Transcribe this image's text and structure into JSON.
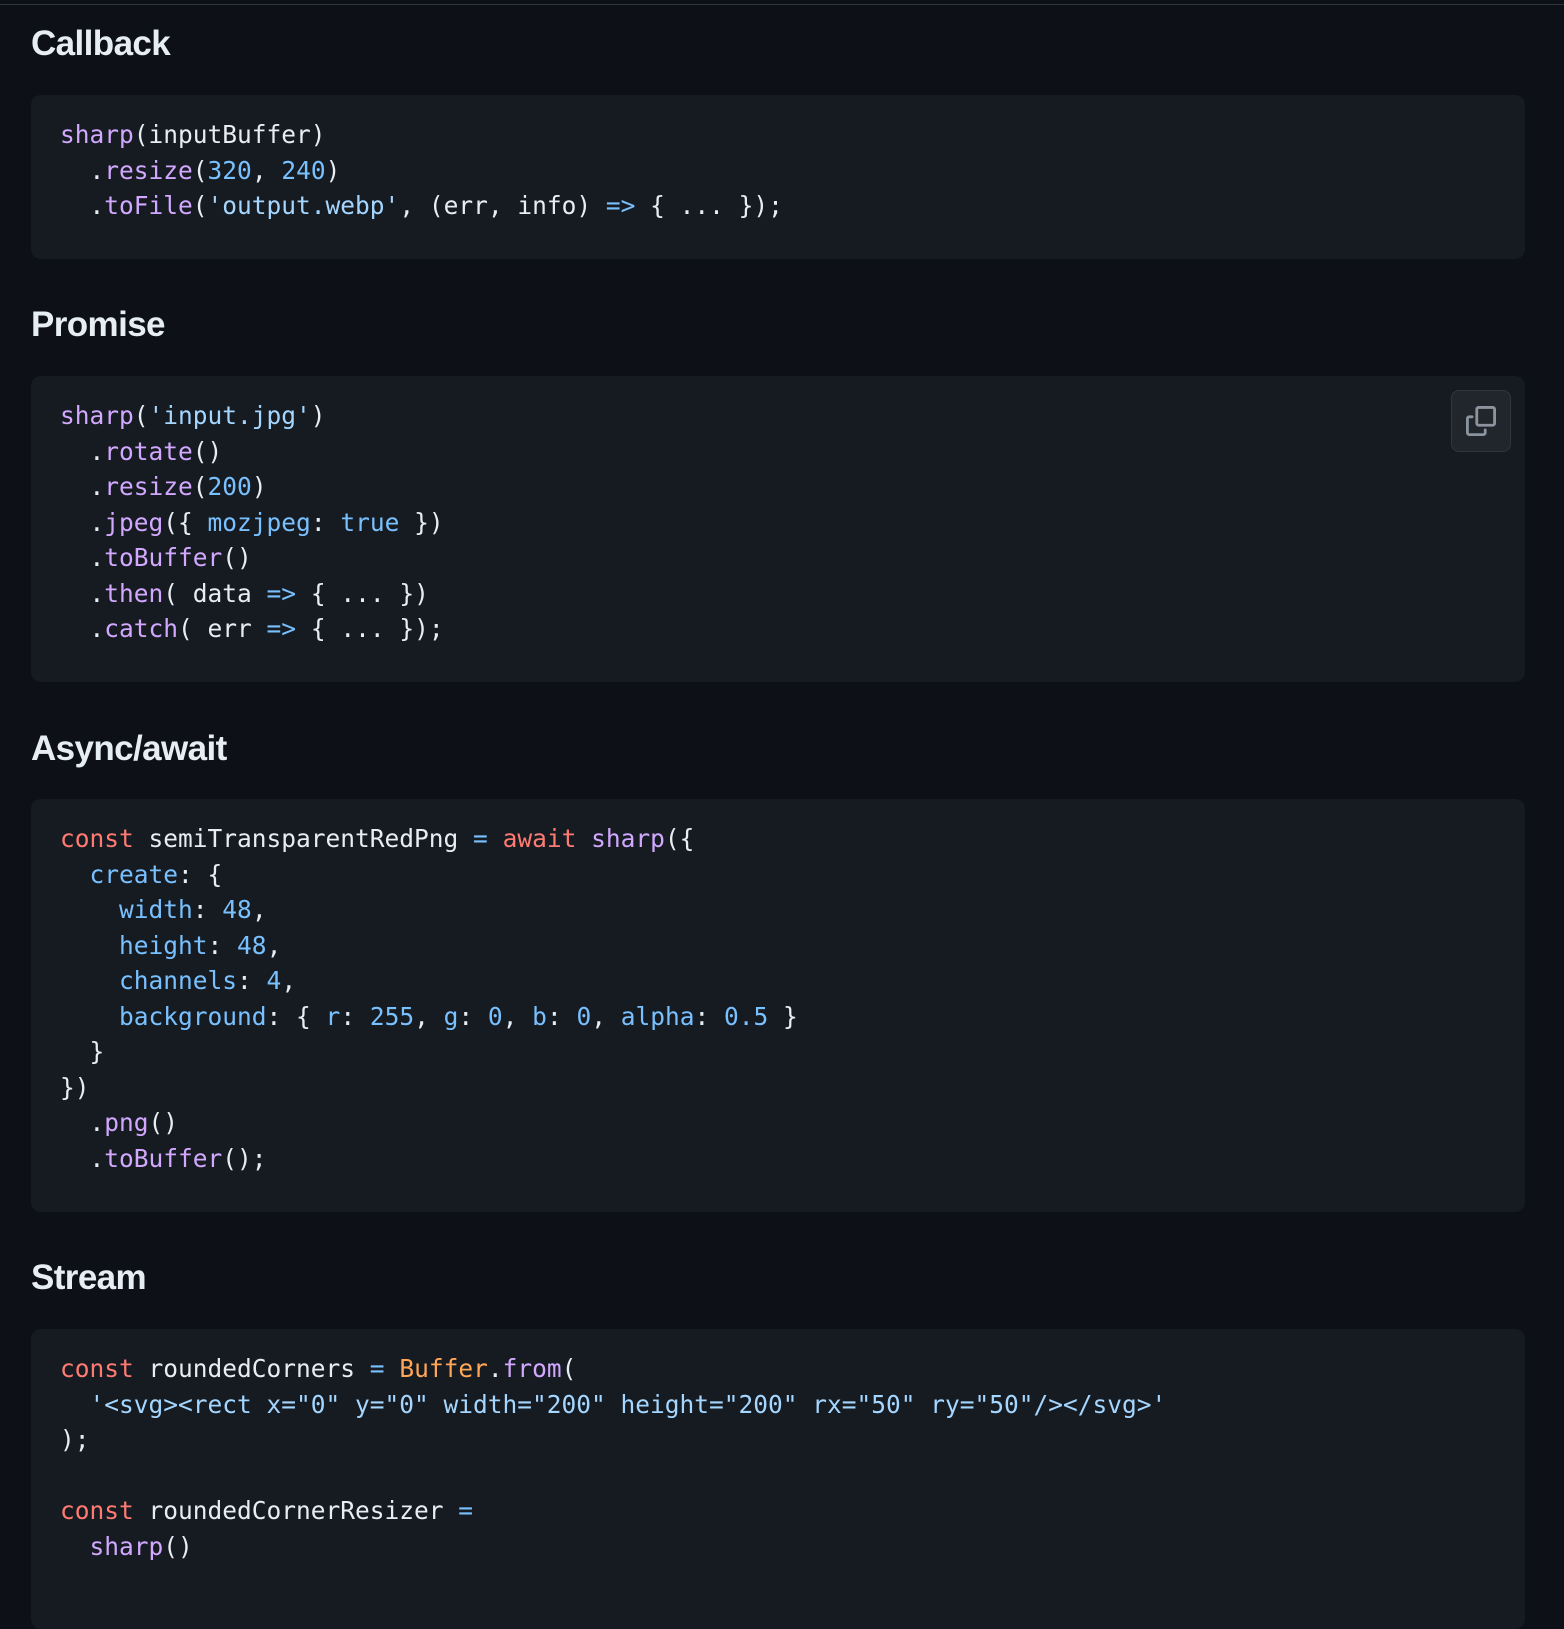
{
  "sections": [
    {
      "heading": "Callback",
      "lines": [
        [
          [
            "f",
            "sharp"
          ],
          [
            "t",
            "(inputBuffer)"
          ]
        ],
        [
          [
            "t",
            "  ."
          ],
          [
            "f",
            "resize"
          ],
          [
            "t",
            "("
          ],
          [
            "n",
            "320"
          ],
          [
            "t",
            ", "
          ],
          [
            "n",
            "240"
          ],
          [
            "t",
            ")"
          ]
        ],
        [
          [
            "t",
            "  ."
          ],
          [
            "f",
            "toFile"
          ],
          [
            "t",
            "("
          ],
          [
            "s",
            "'output.webp'"
          ],
          [
            "t",
            ", (err, info) "
          ],
          [
            "n",
            "=>"
          ],
          [
            "t",
            " { ... });"
          ]
        ]
      ]
    },
    {
      "heading": "Promise",
      "copy_icon": "copy-icon",
      "lines": [
        [
          [
            "f",
            "sharp"
          ],
          [
            "t",
            "("
          ],
          [
            "s",
            "'input.jpg'"
          ],
          [
            "t",
            ")"
          ]
        ],
        [
          [
            "t",
            "  ."
          ],
          [
            "f",
            "rotate"
          ],
          [
            "t",
            "()"
          ]
        ],
        [
          [
            "t",
            "  ."
          ],
          [
            "f",
            "resize"
          ],
          [
            "t",
            "("
          ],
          [
            "n",
            "200"
          ],
          [
            "t",
            ")"
          ]
        ],
        [
          [
            "t",
            "  ."
          ],
          [
            "f",
            "jpeg"
          ],
          [
            "t",
            "({ "
          ],
          [
            "n",
            "mozjpeg"
          ],
          [
            "t",
            ": "
          ],
          [
            "n",
            "true"
          ],
          [
            "t",
            " })"
          ]
        ],
        [
          [
            "t",
            "  ."
          ],
          [
            "f",
            "toBuffer"
          ],
          [
            "t",
            "()"
          ]
        ],
        [
          [
            "t",
            "  ."
          ],
          [
            "f",
            "then"
          ],
          [
            "t",
            "( data "
          ],
          [
            "n",
            "=>"
          ],
          [
            "t",
            " { ... })"
          ]
        ],
        [
          [
            "t",
            "  ."
          ],
          [
            "f",
            "catch"
          ],
          [
            "t",
            "( err "
          ],
          [
            "n",
            "=>"
          ],
          [
            "t",
            " { ... });"
          ]
        ]
      ]
    },
    {
      "heading": "Async/await",
      "lines": [
        [
          [
            "k",
            "const"
          ],
          [
            "t",
            " semiTransparentRedPng "
          ],
          [
            "n",
            "="
          ],
          [
            "t",
            " "
          ],
          [
            "k",
            "await"
          ],
          [
            "t",
            " "
          ],
          [
            "f",
            "sharp"
          ],
          [
            "t",
            "({"
          ]
        ],
        [
          [
            "t",
            "  "
          ],
          [
            "n",
            "create"
          ],
          [
            "t",
            ": {"
          ]
        ],
        [
          [
            "t",
            "    "
          ],
          [
            "n",
            "width"
          ],
          [
            "t",
            ": "
          ],
          [
            "n",
            "48"
          ],
          [
            "t",
            ","
          ]
        ],
        [
          [
            "t",
            "    "
          ],
          [
            "n",
            "height"
          ],
          [
            "t",
            ": "
          ],
          [
            "n",
            "48"
          ],
          [
            "t",
            ","
          ]
        ],
        [
          [
            "t",
            "    "
          ],
          [
            "n",
            "channels"
          ],
          [
            "t",
            ": "
          ],
          [
            "n",
            "4"
          ],
          [
            "t",
            ","
          ]
        ],
        [
          [
            "t",
            "    "
          ],
          [
            "n",
            "background"
          ],
          [
            "t",
            ": { "
          ],
          [
            "n",
            "r"
          ],
          [
            "t",
            ": "
          ],
          [
            "n",
            "255"
          ],
          [
            "t",
            ", "
          ],
          [
            "n",
            "g"
          ],
          [
            "t",
            ": "
          ],
          [
            "n",
            "0"
          ],
          [
            "t",
            ", "
          ],
          [
            "n",
            "b"
          ],
          [
            "t",
            ": "
          ],
          [
            "n",
            "0"
          ],
          [
            "t",
            ", "
          ],
          [
            "n",
            "alpha"
          ],
          [
            "t",
            ": "
          ],
          [
            "n",
            "0.5"
          ],
          [
            "t",
            " }"
          ]
        ],
        [
          [
            "t",
            "  }"
          ]
        ],
        [
          [
            "t",
            "})"
          ]
        ],
        [
          [
            "t",
            "  ."
          ],
          [
            "f",
            "png"
          ],
          [
            "t",
            "()"
          ]
        ],
        [
          [
            "t",
            "  ."
          ],
          [
            "f",
            "toBuffer"
          ],
          [
            "t",
            "();"
          ]
        ]
      ]
    },
    {
      "heading": "Stream",
      "lines": [
        [
          [
            "k",
            "const"
          ],
          [
            "t",
            " roundedCorners "
          ],
          [
            "n",
            "="
          ],
          [
            "t",
            " "
          ],
          [
            "o",
            "Buffer"
          ],
          [
            "t",
            "."
          ],
          [
            "f",
            "from"
          ],
          [
            "t",
            "("
          ]
        ],
        [
          [
            "t",
            "  "
          ],
          [
            "s",
            "'<svg><rect x=\"0\" y=\"0\" width=\"200\" height=\"200\" rx=\"50\" ry=\"50\"/></svg>'"
          ]
        ],
        [
          [
            "t",
            ");"
          ]
        ],
        [
          [
            "t",
            ""
          ]
        ],
        [
          [
            "k",
            "const"
          ],
          [
            "t",
            " roundedCornerResizer "
          ],
          [
            "n",
            "="
          ]
        ],
        [
          [
            "t",
            "  "
          ],
          [
            "f",
            "sharp"
          ],
          [
            "t",
            "()"
          ]
        ]
      ]
    }
  ]
}
